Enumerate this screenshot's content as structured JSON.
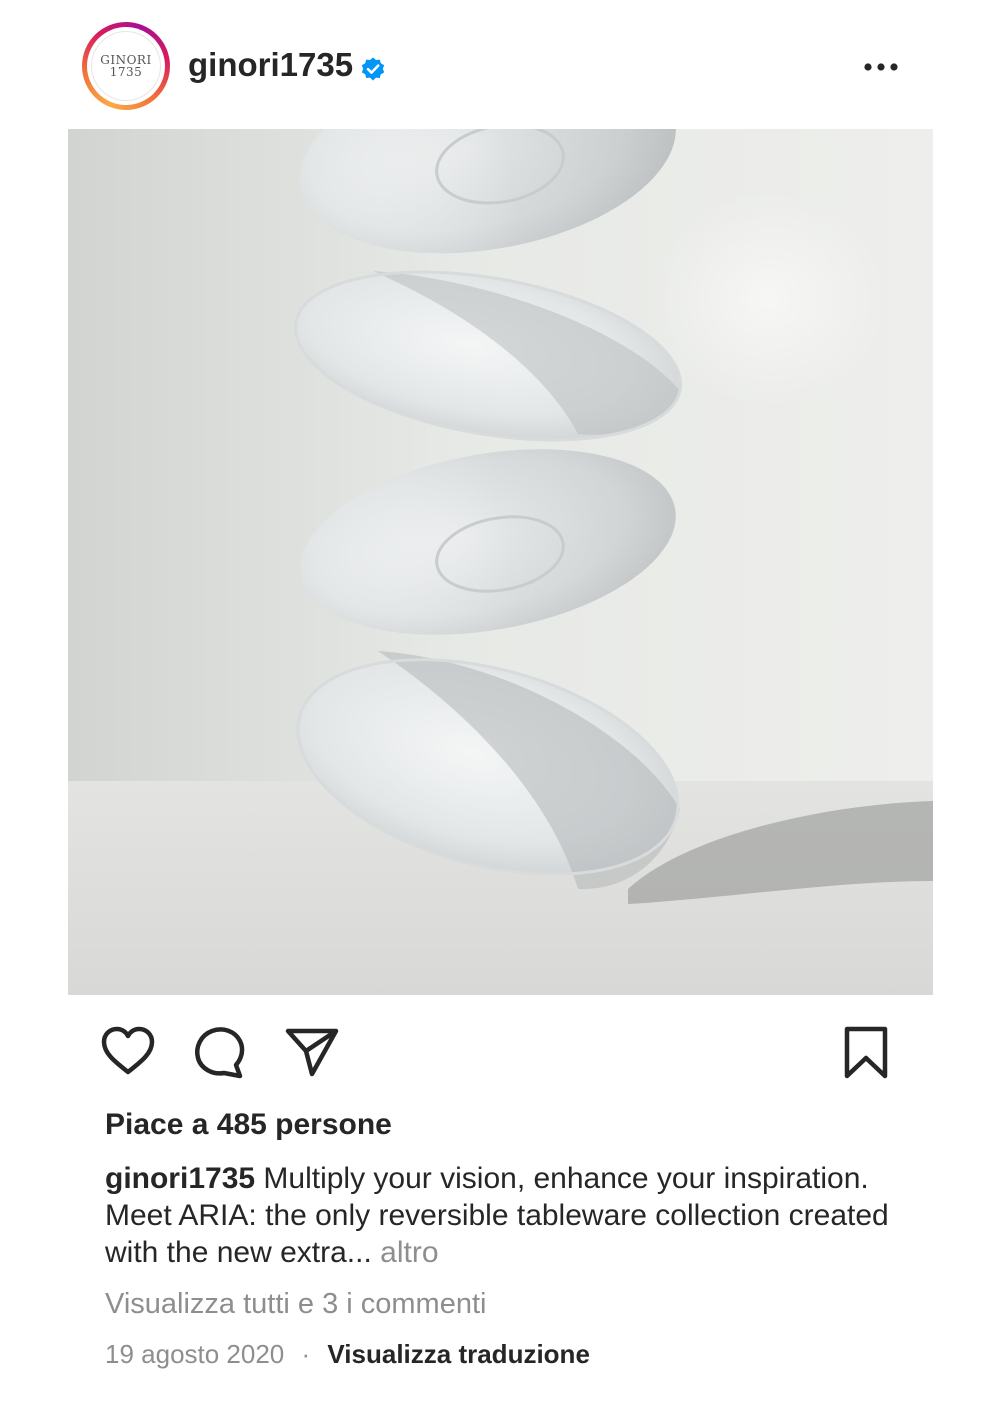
{
  "account": {
    "username": "ginori1735",
    "verified": true,
    "avatar_text_line1": "GINORI",
    "avatar_text_line2": "1735"
  },
  "post": {
    "image": "floating-white-plates",
    "likes_text": "Piace a 485 persone",
    "caption_username": "ginori1735",
    "caption_text": "Multiply your vision, enhance your inspiration. Meet ARIA: the only reversible tableware collection created with the new extra...",
    "caption_more": "altro",
    "view_comments": "Visualizza tutti e 3 i commenti",
    "date": "19 agosto 2020",
    "separator": "·",
    "translate": "Visualizza traduzione"
  },
  "icons": {
    "like": "heart-icon",
    "comment": "comment-icon",
    "share": "send-icon",
    "save": "bookmark-icon",
    "options": "more-icon",
    "verified": "verified-badge-icon"
  },
  "colors": {
    "text": "#262626",
    "secondary": "#8e8e8e",
    "verified": "#0095f6",
    "ring_start": "#fbaa47",
    "ring_mid": "#d91a5f",
    "ring_end": "#a60f93"
  }
}
